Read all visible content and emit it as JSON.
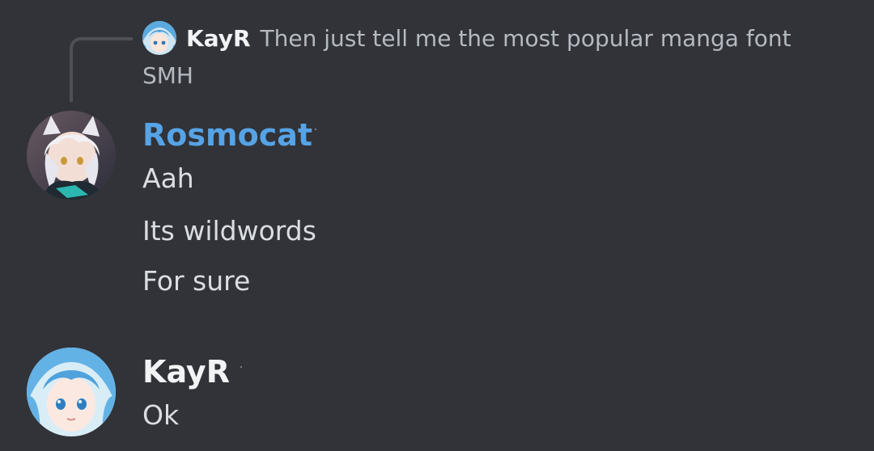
{
  "colors": {
    "background": "#313338",
    "author_rosmocat": "#56a3e6",
    "author_kayr": "#f2f3f5",
    "message_text": "#dbdee1",
    "reply_text": "#b5bac1"
  },
  "reply": {
    "author": "KayR",
    "text": "Then just tell me the most popular manga font",
    "continuation": "SMH",
    "avatar_icon": "blue-hair-anime-avatar"
  },
  "messages": [
    {
      "author": "Rosmocat",
      "avatar_icon": "white-hair-anime-avatar",
      "lines": [
        "Aah",
        "Its wildwords",
        "For sure"
      ]
    },
    {
      "author": "KayR",
      "avatar_icon": "blue-hair-anime-avatar",
      "lines": [
        "Ok"
      ]
    }
  ]
}
